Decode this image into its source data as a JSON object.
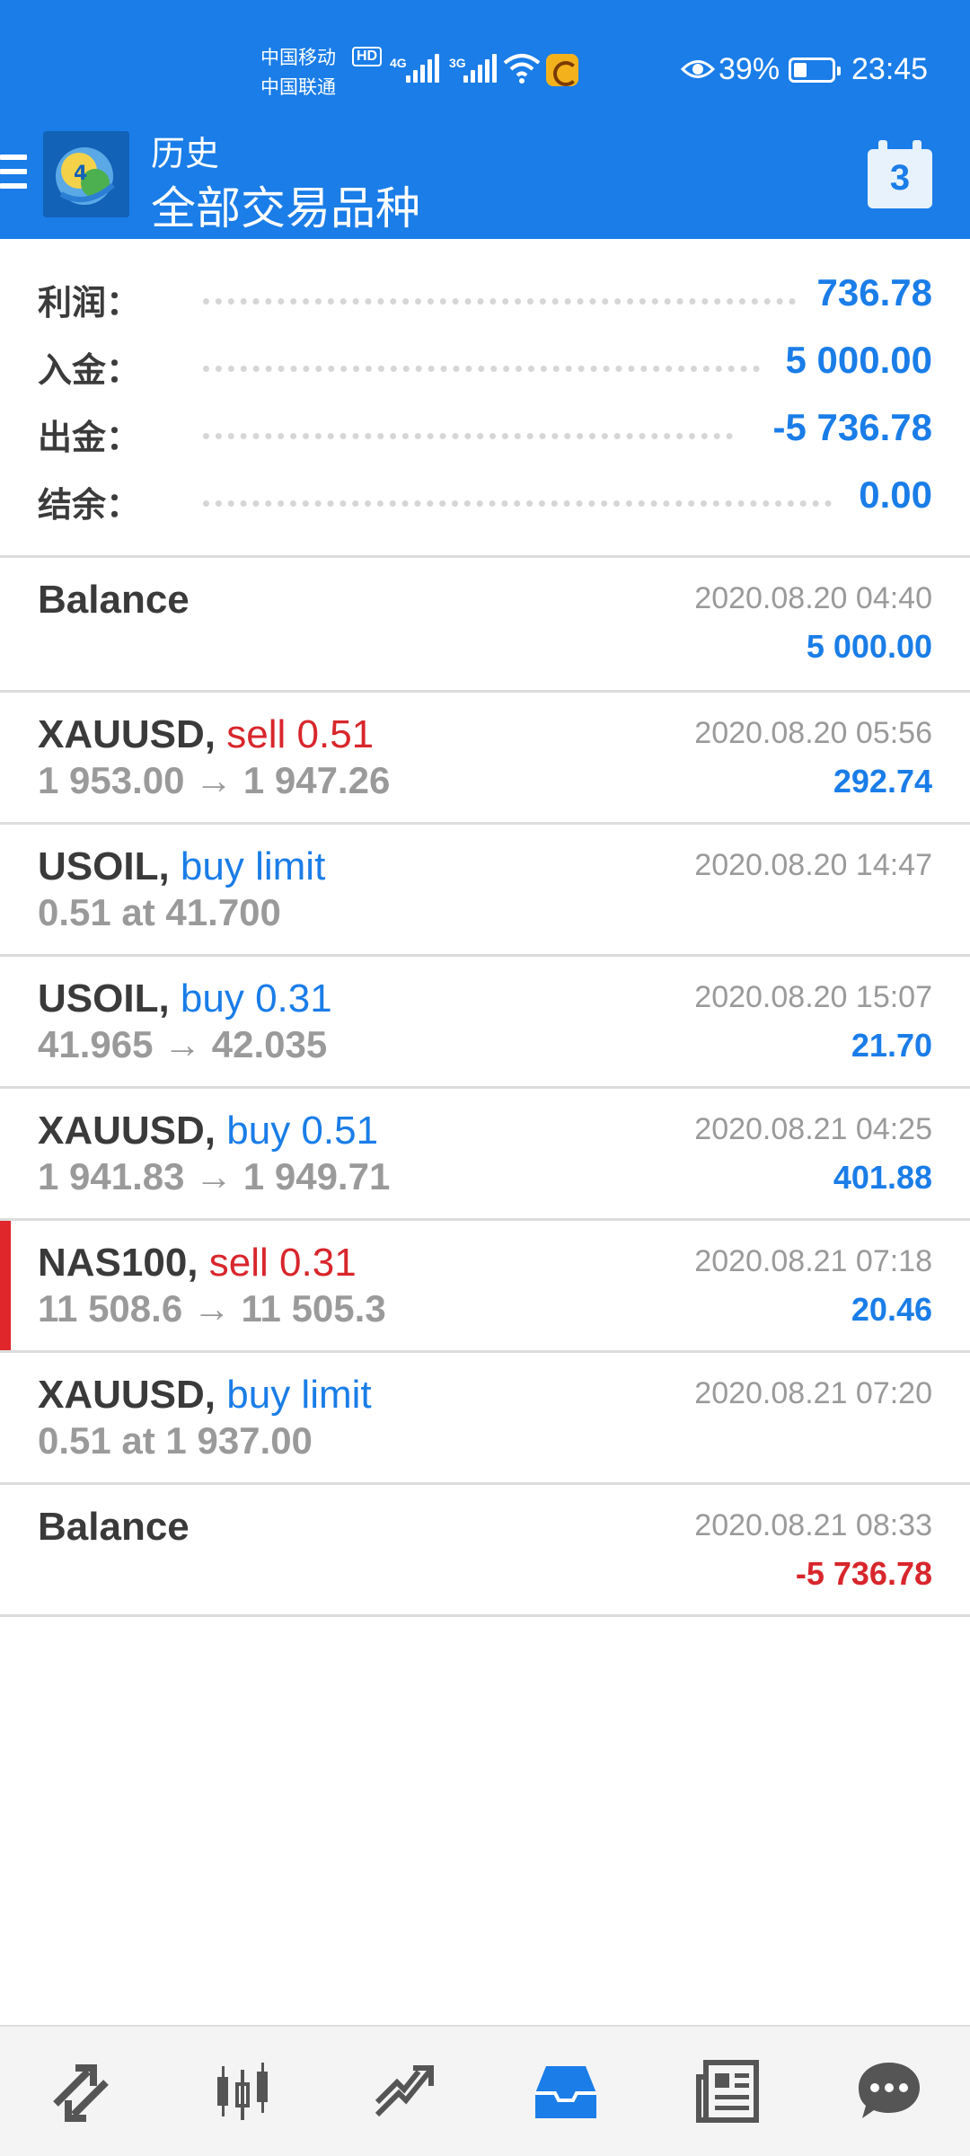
{
  "status_bar": {
    "carrier1": "中国移动",
    "carrier2": "中国联通",
    "hd_badge": "HD",
    "net1": "4G",
    "net2": "3G",
    "battery_percent": "39%",
    "time": "23:45"
  },
  "header": {
    "subtitle": "历史",
    "title": "全部交易品种",
    "calendar_day": "3"
  },
  "summary": {
    "profit": {
      "label": "利润：",
      "value": "736.78"
    },
    "deposit": {
      "label": "入金：",
      "value": "5 000.00"
    },
    "withdrawal": {
      "label": "出金：",
      "value": "-5 736.78"
    },
    "balance": {
      "label": "结余：",
      "value": "0.00"
    }
  },
  "rows": [
    {
      "symbol": "Balance",
      "action": "",
      "detail": "",
      "date": "2020.08.20 04:40",
      "amount": "5 000.00"
    },
    {
      "symbol": "XAUUSD,",
      "action": "sell 0.51",
      "detail": "1 953.00 → 1 947.26",
      "date": "2020.08.20 05:56",
      "amount": "292.74"
    },
    {
      "symbol": "USOIL,",
      "action": "buy limit",
      "detail": "0.51 at 41.700",
      "date": "2020.08.20 14:47",
      "amount": ""
    },
    {
      "symbol": "USOIL,",
      "action": "buy 0.31",
      "detail": "41.965 → 42.035",
      "date": "2020.08.20 15:07",
      "amount": "21.70"
    },
    {
      "symbol": "XAUUSD,",
      "action": "buy 0.51",
      "detail": "1 941.83 → 1 949.71",
      "date": "2020.08.21 04:25",
      "amount": "401.88"
    },
    {
      "symbol": "NAS100,",
      "action": "sell 0.31",
      "detail": "11 508.6 → 11 505.3",
      "date": "2020.08.21 07:18",
      "amount": "20.46"
    },
    {
      "symbol": "XAUUSD,",
      "action": "buy limit",
      "detail": "0.51 at 1 937.00",
      "date": "2020.08.21 07:20",
      "amount": ""
    },
    {
      "symbol": "Balance",
      "action": "",
      "detail": "",
      "date": "2020.08.21 08:33",
      "amount": "-5 736.78"
    }
  ],
  "bottom_nav": [
    {
      "icon": "quotes-icon"
    },
    {
      "icon": "chart-icon"
    },
    {
      "icon": "trade-icon"
    },
    {
      "icon": "history-icon",
      "active": true
    },
    {
      "icon": "news-icon"
    },
    {
      "icon": "messages-icon"
    }
  ],
  "colors": {
    "accent": "#1a7de8",
    "sell": "#d8262c",
    "text_dark": "#3a3a3a",
    "text_muted": "#9a9a9a"
  }
}
